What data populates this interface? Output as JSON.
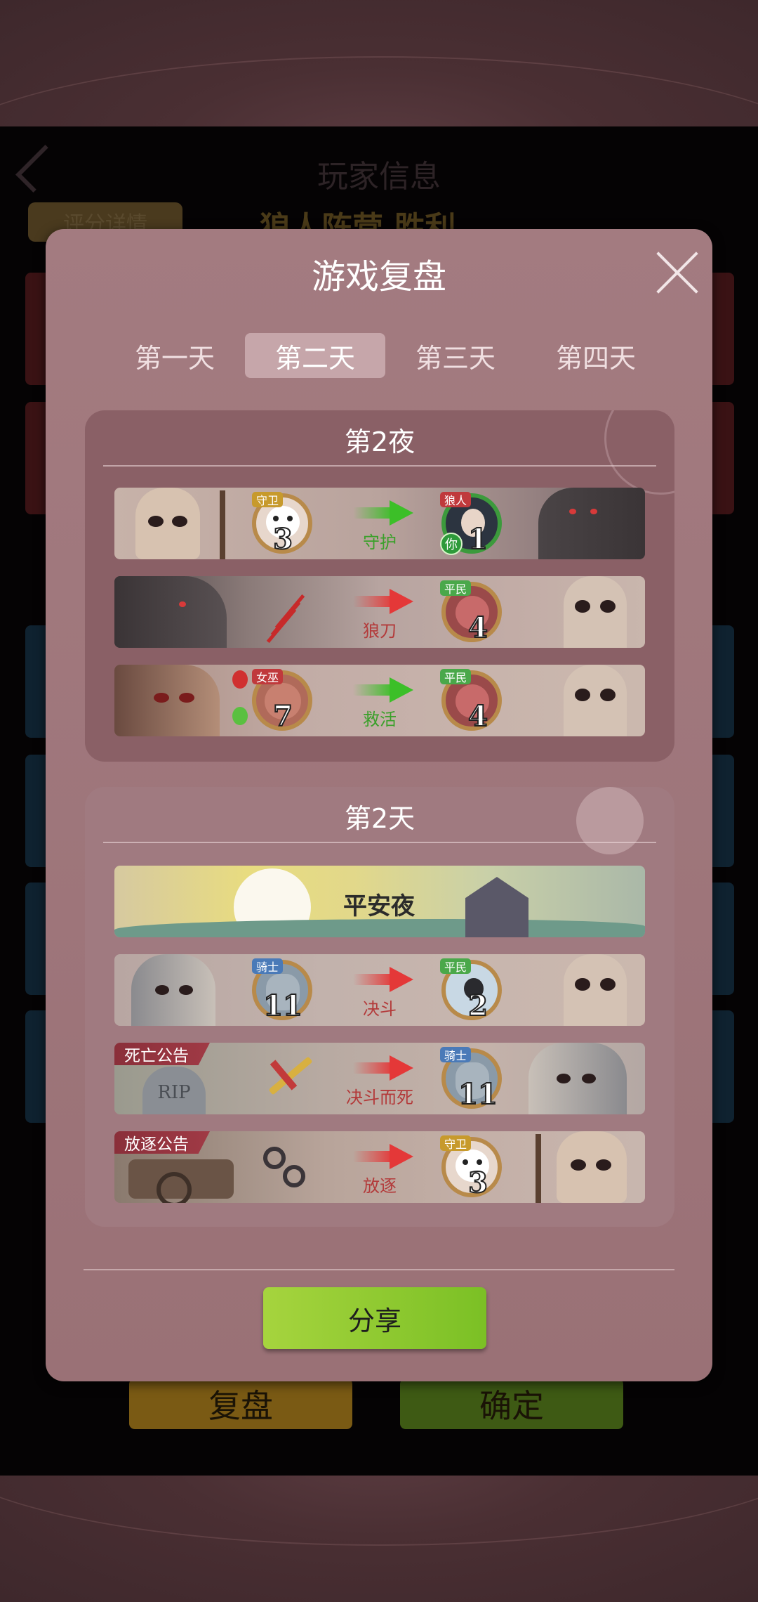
{
  "underlay": {
    "title": "玩家信息",
    "score_detail": "评分详情",
    "camp_result": "狼人阵营  胜利",
    "replay_button": "复盘",
    "confirm_button": "确定"
  },
  "modal": {
    "title": "游戏复盘",
    "tabs": [
      {
        "label": "第一天",
        "active": false
      },
      {
        "label": "第二天",
        "active": true
      },
      {
        "label": "第三天",
        "active": false
      },
      {
        "label": "第四天",
        "active": false
      }
    ],
    "night": {
      "title": "第2夜",
      "rows": [
        {
          "actor_role": "守卫",
          "actor_num": "3",
          "action": "守护",
          "arrow": "green",
          "target_role": "狼人",
          "target_num": "1",
          "target_you": "你"
        },
        {
          "actor_role": "",
          "actor_num": "",
          "action": "狼刀",
          "arrow": "red",
          "target_role": "平民",
          "target_num": "4"
        },
        {
          "actor_role": "女巫",
          "actor_num": "7",
          "action": "救活",
          "arrow": "green",
          "target_role": "平民",
          "target_num": "4"
        }
      ]
    },
    "day": {
      "title": "第2天",
      "peace": "平安夜",
      "rows": [
        {
          "actor_role": "骑士",
          "actor_num": "11",
          "action": "决斗",
          "arrow": "red",
          "target_role": "平民",
          "target_num": "2"
        },
        {
          "announce": "死亡公告",
          "action": "决斗而死",
          "arrow": "red",
          "target_role": "骑士",
          "target_num": "11"
        },
        {
          "announce": "放逐公告",
          "action": "放逐",
          "arrow": "red",
          "target_role": "守卫",
          "target_num": "3"
        }
      ]
    },
    "share_button": "分享"
  },
  "colors": {
    "modal_bg": "#a37b80",
    "active_tab": "#c6a6aa",
    "share_button": "#8cc832",
    "green_arrow": "#3cbf28",
    "red_arrow": "#e43838"
  }
}
